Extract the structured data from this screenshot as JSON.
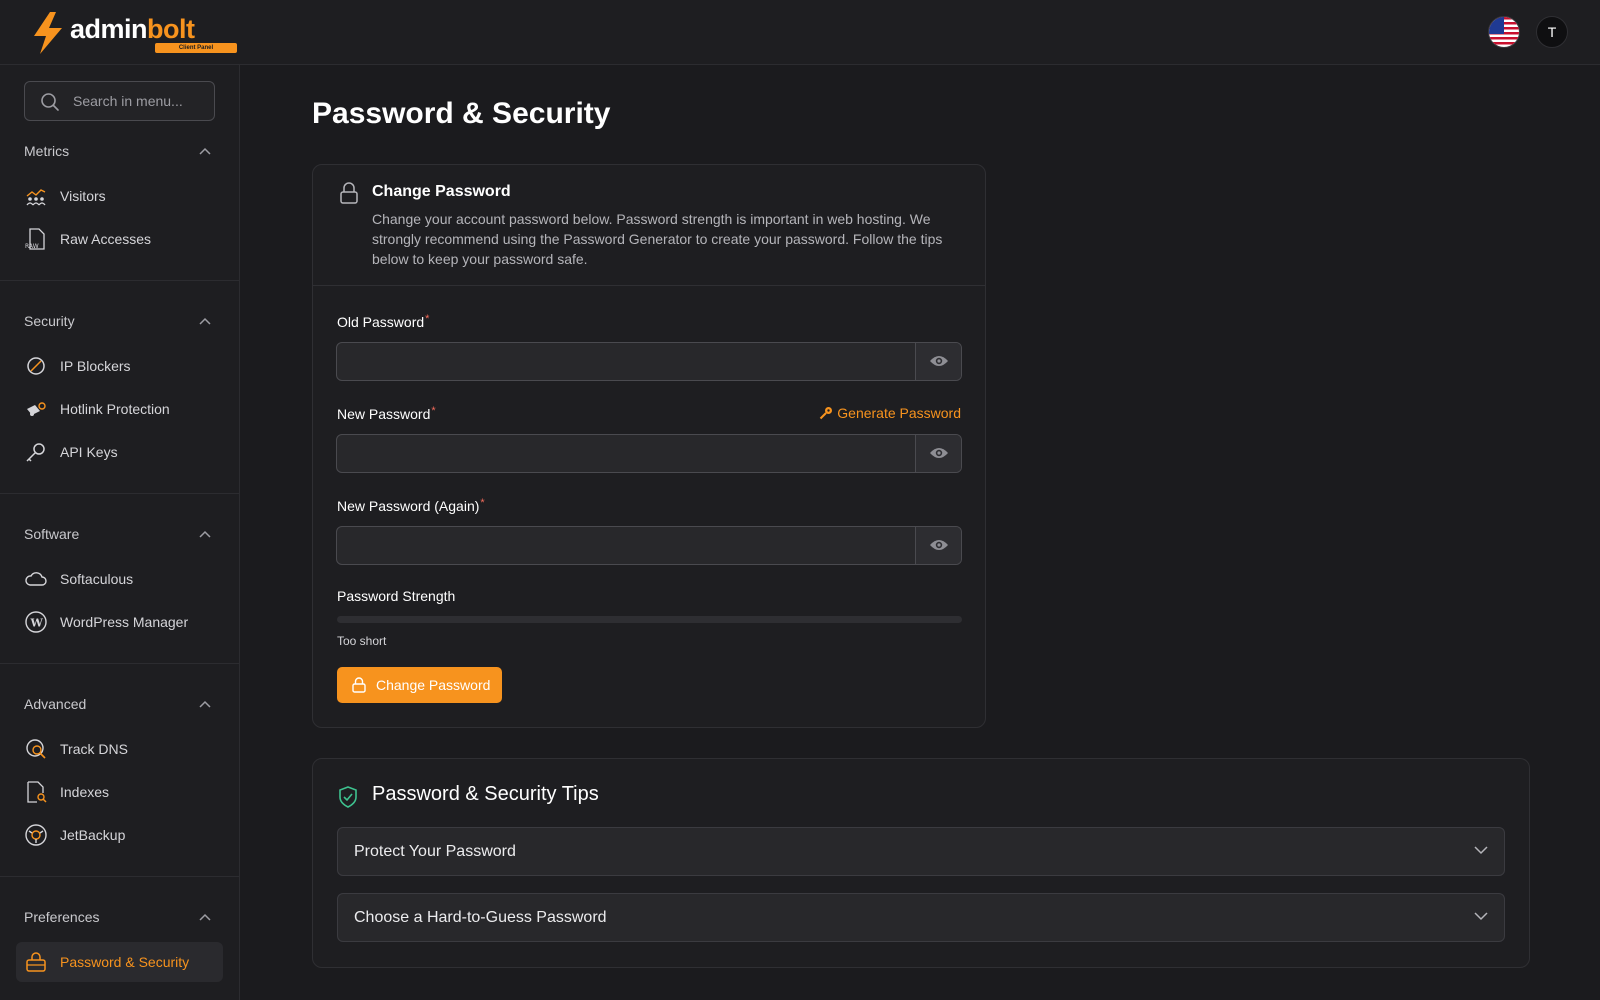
{
  "header": {
    "brand_main": "admin",
    "brand_accent": "bolt",
    "brand_badge": "Client Panel",
    "avatar_initial": "T",
    "colors": {
      "accent": "#f7931e",
      "background": "#1b1b1e"
    }
  },
  "sidebar": {
    "search_placeholder": "Search in menu...",
    "groups": [
      {
        "title": "Metrics",
        "items": [
          {
            "label": "Visitors",
            "icon": "chart-people-icon"
          },
          {
            "label": "Raw Accesses",
            "icon": "raw-file-icon"
          }
        ]
      },
      {
        "title": "Security",
        "items": [
          {
            "label": "IP Blockers",
            "icon": "block-icon"
          },
          {
            "label": "Hotlink Protection",
            "icon": "hotlink-icon"
          },
          {
            "label": "API Keys",
            "icon": "key-icon"
          }
        ]
      },
      {
        "title": "Software",
        "items": [
          {
            "label": "Softaculous",
            "icon": "cloud-icon"
          },
          {
            "label": "WordPress Manager",
            "icon": "wordpress-icon"
          }
        ]
      },
      {
        "title": "Advanced",
        "items": [
          {
            "label": "Track DNS",
            "icon": "dns-search-icon"
          },
          {
            "label": "Indexes",
            "icon": "file-search-icon"
          },
          {
            "label": "JetBackup",
            "icon": "backup-icon"
          }
        ]
      },
      {
        "title": "Preferences",
        "items": [
          {
            "label": "Password & Security",
            "icon": "lock-box-icon",
            "active": true
          }
        ]
      }
    ]
  },
  "main": {
    "page_title": "Password & Security",
    "change_card": {
      "title": "Change Password",
      "description": "Change your account password below. Password strength is important in web hosting. We strongly recommend using the Password Generator to create your password. Follow the tips below to keep your password safe.",
      "old_password_label": "Old Password",
      "new_password_label": "New Password",
      "new_password_again_label": "New Password (Again)",
      "required_mark": "*",
      "generate_label": "Generate Password",
      "strength_label": "Password Strength",
      "strength_value": 0,
      "strength_text": "Too short",
      "submit_label": "Change Password"
    },
    "tips_card": {
      "title": "Password & Security Tips",
      "items": [
        {
          "label": "Protect Your Password"
        },
        {
          "label": "Choose a Hard-to-Guess Password"
        }
      ]
    }
  }
}
